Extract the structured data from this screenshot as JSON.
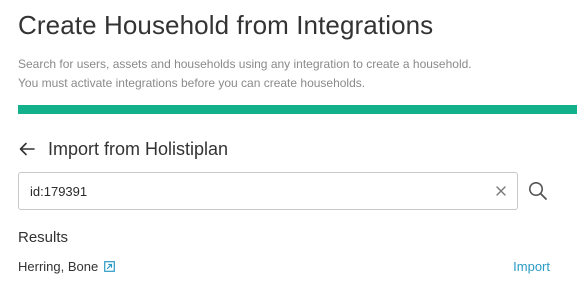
{
  "header": {
    "title": "Create Household from Integrations",
    "description_lines": [
      "Search for users, assets and households using any integration to create a household.",
      "You must activate integrations before you can create households."
    ]
  },
  "progress": {
    "value_percent": 100,
    "color": "#12b08b"
  },
  "import_section": {
    "title": "Import from Holistiplan",
    "back_icon": "arrow-left-icon"
  },
  "search": {
    "value": "id:179391",
    "clear_icon": "close-icon",
    "search_icon": "search-icon"
  },
  "results": {
    "heading": "Results",
    "items": [
      {
        "name": "Herring, Bone",
        "link_icon": "external-link-icon",
        "action_label": "Import"
      }
    ]
  },
  "colors": {
    "accent": "#12b08b",
    "link": "#2a9bc4"
  }
}
